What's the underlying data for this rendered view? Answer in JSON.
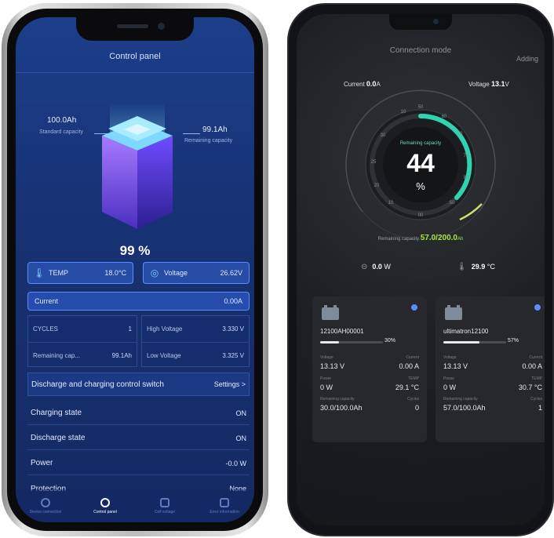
{
  "left": {
    "title": "Control panel",
    "standard_capacity_value": "100.0Ah",
    "standard_capacity_label": "Standard capacity",
    "remaining_capacity_value": "99.1Ah",
    "remaining_capacity_label": "Remaining capacity",
    "percent": "99 %",
    "temp_label": "TEMP",
    "temp_value": "18.0°C",
    "voltage_label": "Voltage",
    "voltage_value": "26.62V",
    "current_label": "Current",
    "current_value": "0.00A",
    "cycles_label": "CYCLES",
    "cycles_value": "1",
    "remaining_short_label": "Remaining cap...",
    "remaining_short_value": "99.1Ah",
    "high_voltage_label": "High Voltage",
    "high_voltage_value": "3.330 V",
    "low_voltage_label": "Low Voltage",
    "low_voltage_value": "3.325 V",
    "switch_label": "Discharge and charging control switch",
    "settings_label": "Settings >",
    "charging_label": "Charging state",
    "charging_value": "ON",
    "discharge_label": "Discharge state",
    "discharge_value": "ON",
    "power_label": "Power",
    "power_value": "-0.0 W",
    "protection_label": "Protection",
    "protection_value": "None",
    "tabs": [
      "Device connection",
      "Control panel",
      "Cell voltage",
      "Error information"
    ]
  },
  "right": {
    "title": "Connection mode",
    "adding": "Adding",
    "current_label": "Current",
    "current_value": "0.0",
    "current_unit": "A",
    "voltage_label": "Voltage",
    "voltage_value": "13.1",
    "voltage_unit": "V",
    "gauge_label": "Remaining capacity",
    "gauge_value": "44",
    "gauge_unit": "%",
    "gauge_ticks": [
      "10",
      "50",
      "60",
      "70",
      "75",
      "80",
      "50",
      "00",
      "10",
      "20",
      "25",
      "30"
    ],
    "remain_label": "Remaining capacity",
    "remain_value": "57.0/200.0",
    "remain_unit": "Ah",
    "power_value": "0.0",
    "power_unit": "W",
    "temp_value": "29.9",
    "temp_unit": "°C",
    "cards": [
      {
        "name": "12100AH00001",
        "percent": "30%",
        "percent_fraction": 0.3,
        "voltage_label": "Voltage",
        "voltage_value": "13.13 V",
        "current_label": "Current",
        "current_value": "0.00 A",
        "power_label": "Power",
        "power_value": "0 W",
        "temp_label": "TEMP",
        "temp_value": "29.1 °C",
        "remain_label": "Remaining capacity",
        "remain_value": "30.0/100.0Ah",
        "cycles_label": "Cycles",
        "cycles_value": "0"
      },
      {
        "name": "ultimatron12100",
        "percent": "57%",
        "percent_fraction": 0.57,
        "voltage_label": "Voltage",
        "voltage_value": "13.13 V",
        "current_label": "Current",
        "current_value": "0.00 A",
        "power_label": "Power",
        "power_value": "0 W",
        "temp_label": "TEMP",
        "temp_value": "30.7 °C",
        "remain_label": "Remaining capacity",
        "remain_value": "57.0/100.0Ah",
        "cycles_label": "Cycles",
        "cycles_value": "1"
      }
    ]
  },
  "colors": {
    "left_bg": "#173274",
    "accent_blue": "#5b8cff",
    "gauge_teal": "#6fd8c0",
    "capacity_green": "#a6e34a",
    "right_bg": "#1e2024"
  }
}
